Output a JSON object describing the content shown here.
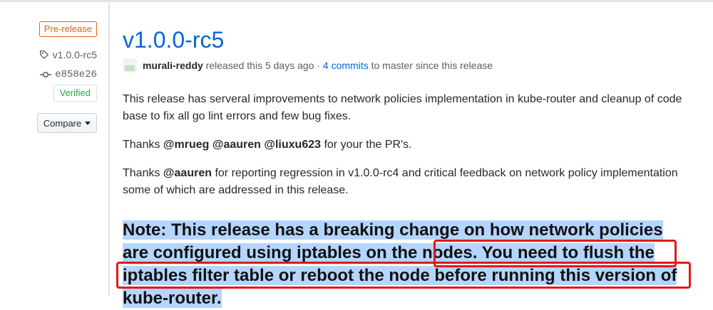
{
  "sidebar": {
    "pre_release_label": "Pre-release",
    "tag_label": "v1.0.0-rc5",
    "commit_label": "e858e26",
    "verified_label": "Verified",
    "compare_label": "Compare"
  },
  "release": {
    "title": "v1.0.0-rc5",
    "author": "murali-reddy",
    "released_text": " released this 5 days ago · ",
    "commits_link": "4 commits",
    "since_text": " to master since this release",
    "para1": "This release has serveral improvements to network policies implementation in kube-router and cleanup of code base to fix all go lint errors and few bug fixes.",
    "para2_prefix": "Thanks ",
    "para2_mentions": "@mrueg @aauren @liuxu623",
    "para2_suffix": " for your the PR's.",
    "para3_prefix": "Thanks ",
    "para3_mention": "@aauren",
    "para3_suffix": " for reporting regression in v1.0.0-rc4 and critical feedback on network policy implementation some of which are addressed in this release.",
    "note_part1": "Note: This release has a breaking change on how network policies are configured using iptables on the nodes.",
    "note_part2": " You need to flush the iptables filter table or reboot the node before running this version of kube-router."
  },
  "icons": {
    "tag": "tag-icon",
    "commit": "git-commit-icon",
    "caret": "caret-down-icon",
    "avatar": "avatar"
  },
  "colors": {
    "link": "#0366d6",
    "pre_release": "#e36209",
    "verified": "#28a745",
    "highlight": "#b4d5fe",
    "annotation_box": "#e0191a"
  }
}
